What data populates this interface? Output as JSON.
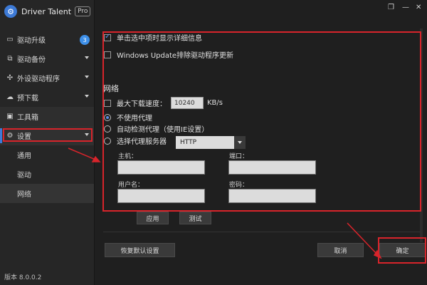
{
  "app": {
    "name": "Driver Talent",
    "badge": "Pro",
    "version": "版本 8.0.0.2"
  },
  "colors": {
    "accent": "#3d7ad6",
    "highlight": "#d8242b",
    "badge": "#3d8fe8"
  },
  "sidebar": {
    "items": [
      {
        "label": "驱动升级",
        "icon": "monitor-icon",
        "count": "3"
      },
      {
        "label": "驱动备份",
        "icon": "backup-icon"
      },
      {
        "label": "外设驱动程序",
        "icon": "plug-icon"
      },
      {
        "label": "预下载",
        "icon": "cloud-download-icon"
      },
      {
        "label": "工具箱",
        "icon": "toolbox-icon"
      },
      {
        "label": "设置",
        "icon": "gear-icon"
      }
    ],
    "sub_items": [
      {
        "label": "通用"
      },
      {
        "label": "驱动"
      },
      {
        "label": "网络"
      }
    ]
  },
  "settings": {
    "show_details_label": "单击选中项时显示详细信息",
    "show_details_checked": true,
    "exclude_wu_label": "Windows Update排除驱动程序更新",
    "exclude_wu_checked": false,
    "network_title": "网络",
    "max_speed_label": "最大下载速度：",
    "max_speed_value": "10240",
    "max_speed_unit": "KB/s",
    "proxy_options": [
      {
        "label": "不使用代理",
        "selected": true
      },
      {
        "label": "自动检测代理（使用IE设置）",
        "selected": false
      },
      {
        "label": "选择代理服务器",
        "selected": false
      }
    ],
    "proxy_type": "HTTP",
    "host_label": "主机：",
    "port_label": "端口：",
    "user_label": "用户名：",
    "password_label": "密码："
  },
  "buttons": {
    "apply": "应用",
    "test": "测试",
    "restore": "恢复默认设置",
    "cancel": "取消",
    "ok": "确定"
  }
}
